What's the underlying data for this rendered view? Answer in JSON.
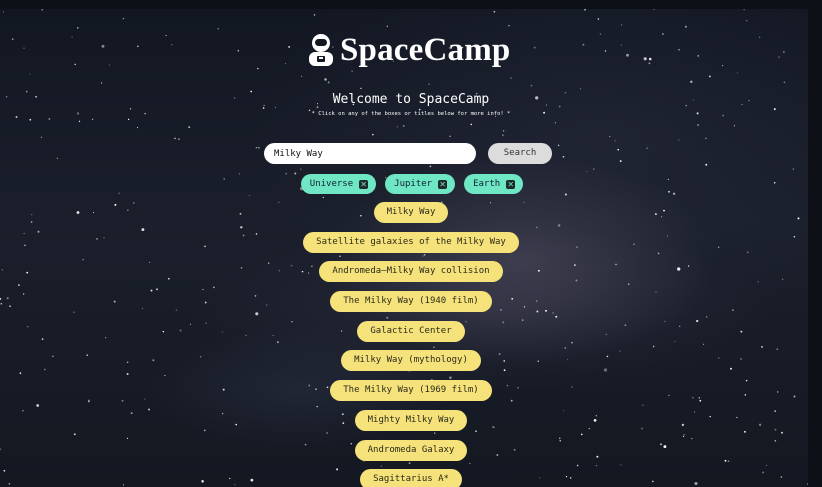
{
  "app": {
    "brand": "SpaceCamp"
  },
  "header": {
    "welcome": "Welcome to SpaceCamp",
    "hint": "* Click on any of the boxes or titles below for more info! *"
  },
  "search": {
    "value": "Milky Way",
    "button_label": "Search"
  },
  "tags": [
    {
      "label": "Universe",
      "close_icon": "close-icon"
    },
    {
      "label": "Jupiter",
      "close_icon": "close-icon"
    },
    {
      "label": "Earth",
      "close_icon": "close-icon"
    }
  ],
  "results": [
    {
      "label": "Milky Way"
    },
    {
      "label": "Satellite galaxies of the Milky Way"
    },
    {
      "label": "Andromeda–Milky Way collision"
    },
    {
      "label": "The Milky Way (1940 film)"
    },
    {
      "label": "Galactic Center"
    },
    {
      "label": "Milky Way (mythology)"
    },
    {
      "label": "The Milky Way (1969 film)"
    },
    {
      "label": "Mighty Milky Way"
    },
    {
      "label": "Andromeda Galaxy"
    },
    {
      "label": "Sagittarius A*"
    }
  ],
  "colors": {
    "tag_bg": "#6fe6c4",
    "result_bg": "#f6e27a",
    "search_button_bg": "#dcdcdc",
    "background": "#121722"
  },
  "icons": {
    "logo": "astronaut-icon",
    "tag_close": "close-icon"
  }
}
